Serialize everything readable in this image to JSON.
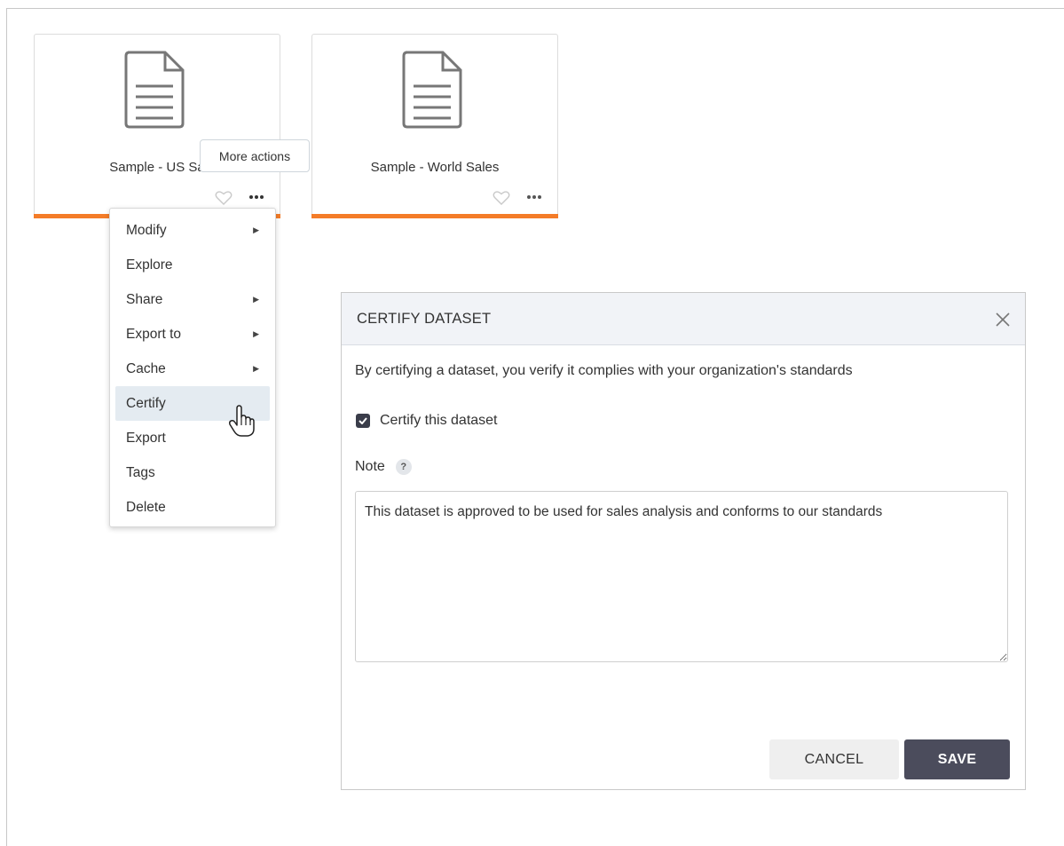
{
  "cards": [
    {
      "title": "Sample - US Sa",
      "icon": "document-icon"
    },
    {
      "title": "Sample - World Sales",
      "icon": "document-icon"
    }
  ],
  "tooltip": {
    "text": "More actions"
  },
  "menu": {
    "items": [
      {
        "label": "Modify",
        "submenu": "▶"
      },
      {
        "label": "Explore",
        "submenu": ""
      },
      {
        "label": "Share",
        "submenu": "▶"
      },
      {
        "label": "Export to",
        "submenu": "▶"
      },
      {
        "label": "Cache",
        "submenu": "▶"
      },
      {
        "label": "Certify",
        "submenu": ""
      },
      {
        "label": "Export",
        "submenu": ""
      },
      {
        "label": "Tags",
        "submenu": ""
      },
      {
        "label": "Delete",
        "submenu": ""
      }
    ],
    "active": "Certify"
  },
  "dialog": {
    "title": "CERTIFY DATASET",
    "description": "By certifying a dataset, you verify it complies with your organization's standards",
    "checkbox_label": "Certify this dataset",
    "checkbox_checked": true,
    "note_label": "Note",
    "help_glyph": "?",
    "note_value": "This dataset is approved to be used for sales analysis and conforms to our standards",
    "cancel_label": "CANCEL",
    "save_label": "SAVE"
  },
  "colors": {
    "accent": "#f47c28",
    "save_button": "#4b4c5c",
    "menu_highlight": "#e4ebf1",
    "dialog_header": "#f1f3f7"
  }
}
